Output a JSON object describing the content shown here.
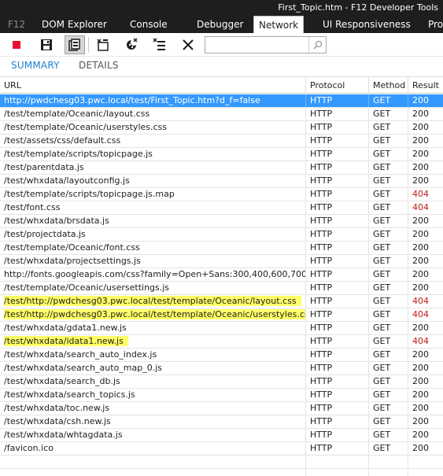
{
  "window": {
    "title": "First_Topic.htm - F12 Developer Tools"
  },
  "tabs": [
    {
      "label": "F12"
    },
    {
      "label": "DOM Explorer"
    },
    {
      "label": "Console"
    },
    {
      "label": "Debugger"
    },
    {
      "label": "Network"
    },
    {
      "label": "UI Responsiveness"
    },
    {
      "label": "Pro"
    }
  ],
  "toolbar": {
    "icons": [
      "stop-recording-icon",
      "save-icon",
      "always-refresh-icon",
      "clear-cache-icon",
      "clear-cookies-icon",
      "clear-entries-icon",
      "close-icon"
    ],
    "search": {
      "value": "",
      "placeholder": ""
    },
    "colors": {
      "stop": "#e8112d",
      "pressed": "#d6d6d6"
    }
  },
  "subtabs": {
    "summary": "SUMMARY",
    "details": "DETAILS"
  },
  "columns": {
    "url": "URL",
    "protocol": "Protocol",
    "method": "Method",
    "result": "Result"
  },
  "rows": [
    {
      "url": "http://pwdchesg03.pwc.local/test/First_Topic.htm?d_f=false",
      "protocol": "HTTP",
      "method": "GET",
      "result": "200",
      "selected": true,
      "highlight": false
    },
    {
      "url": "/test/template/Oceanic/layout.css",
      "protocol": "HTTP",
      "method": "GET",
      "result": "200",
      "selected": false,
      "highlight": false
    },
    {
      "url": "/test/template/Oceanic/userstyles.css",
      "protocol": "HTTP",
      "method": "GET",
      "result": "200",
      "selected": false,
      "highlight": false
    },
    {
      "url": "/test/assets/css/default.css",
      "protocol": "HTTP",
      "method": "GET",
      "result": "200",
      "selected": false,
      "highlight": false
    },
    {
      "url": "/test/template/scripts/topicpage.js",
      "protocol": "HTTP",
      "method": "GET",
      "result": "200",
      "selected": false,
      "highlight": false
    },
    {
      "url": "/test/parentdata.js",
      "protocol": "HTTP",
      "method": "GET",
      "result": "200",
      "selected": false,
      "highlight": false
    },
    {
      "url": "/test/whxdata/layoutconfig.js",
      "protocol": "HTTP",
      "method": "GET",
      "result": "200",
      "selected": false,
      "highlight": false
    },
    {
      "url": "/test/template/scripts/topicpage.js.map",
      "protocol": "HTTP",
      "method": "GET",
      "result": "404",
      "selected": false,
      "highlight": false
    },
    {
      "url": "/test/font.css",
      "protocol": "HTTP",
      "method": "GET",
      "result": "404",
      "selected": false,
      "highlight": false
    },
    {
      "url": "/test/whxdata/brsdata.js",
      "protocol": "HTTP",
      "method": "GET",
      "result": "200",
      "selected": false,
      "highlight": false
    },
    {
      "url": "/test/projectdata.js",
      "protocol": "HTTP",
      "method": "GET",
      "result": "200",
      "selected": false,
      "highlight": false
    },
    {
      "url": "/test/template/Oceanic/font.css",
      "protocol": "HTTP",
      "method": "GET",
      "result": "200",
      "selected": false,
      "highlight": false
    },
    {
      "url": "/test/whxdata/projectsettings.js",
      "protocol": "HTTP",
      "method": "GET",
      "result": "200",
      "selected": false,
      "highlight": false
    },
    {
      "url": "http://fonts.googleapis.com/css?family=Open+Sans:300,400,600,700,800",
      "protocol": "HTTP",
      "method": "GET",
      "result": "200",
      "selected": false,
      "highlight": false
    },
    {
      "url": "/test/template/Oceanic/usersettings.js",
      "protocol": "HTTP",
      "method": "GET",
      "result": "200",
      "selected": false,
      "highlight": false
    },
    {
      "url": "/test/http://pwdchesg03.pwc.local/test/template/Oceanic/layout.css",
      "protocol": "HTTP",
      "method": "GET",
      "result": "404",
      "selected": false,
      "highlight": true
    },
    {
      "url": "/test/http://pwdchesg03.pwc.local/test/template/Oceanic/userstyles.css",
      "protocol": "HTTP",
      "method": "GET",
      "result": "404",
      "selected": false,
      "highlight": true
    },
    {
      "url": "/test/whxdata/gdata1.new.js",
      "protocol": "HTTP",
      "method": "GET",
      "result": "200",
      "selected": false,
      "highlight": false
    },
    {
      "url": "/test/whxdata/idata1.new.js",
      "protocol": "HTTP",
      "method": "GET",
      "result": "404",
      "selected": false,
      "highlight": true
    },
    {
      "url": "/test/whxdata/search_auto_index.js",
      "protocol": "HTTP",
      "method": "GET",
      "result": "200",
      "selected": false,
      "highlight": false
    },
    {
      "url": "/test/whxdata/search_auto_map_0.js",
      "protocol": "HTTP",
      "method": "GET",
      "result": "200",
      "selected": false,
      "highlight": false
    },
    {
      "url": "/test/whxdata/search_db.js",
      "protocol": "HTTP",
      "method": "GET",
      "result": "200",
      "selected": false,
      "highlight": false
    },
    {
      "url": "/test/whxdata/search_topics.js",
      "protocol": "HTTP",
      "method": "GET",
      "result": "200",
      "selected": false,
      "highlight": false
    },
    {
      "url": "/test/whxdata/toc.new.js",
      "protocol": "HTTP",
      "method": "GET",
      "result": "200",
      "selected": false,
      "highlight": false
    },
    {
      "url": "/test/whxdata/csh.new.js",
      "protocol": "HTTP",
      "method": "GET",
      "result": "200",
      "selected": false,
      "highlight": false
    },
    {
      "url": "/test/whxdata/whtagdata.js",
      "protocol": "HTTP",
      "method": "GET",
      "result": "200",
      "selected": false,
      "highlight": false
    },
    {
      "url": "/favicon.ico",
      "protocol": "HTTP",
      "method": "GET",
      "result": "200",
      "selected": false,
      "highlight": false
    }
  ],
  "colors": {
    "selected_row": "#3399ff",
    "highlight": "#ffff66",
    "error_result": "#c01818",
    "accent": "#1e7fcf"
  }
}
